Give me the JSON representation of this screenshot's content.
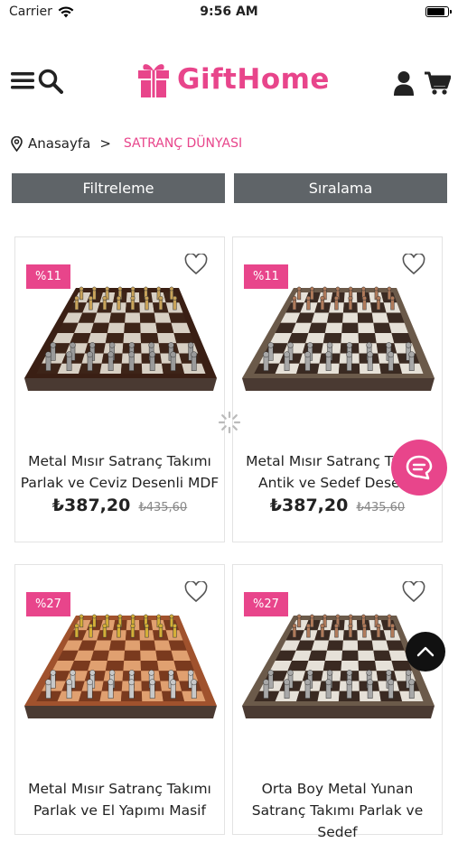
{
  "status_bar": {
    "carrier": "Carrier",
    "time": "9:56 AM",
    "battery_level": 0.9
  },
  "header": {
    "logo_text": "GiftHome",
    "brand_color": "#e8458b"
  },
  "breadcrumb": {
    "home": "Anasayfa",
    "separator": ">",
    "current": "SATRANÇ DÜNYASI"
  },
  "controls": {
    "filter_label": "Filtreleme",
    "sort_label": "Sıralama"
  },
  "products": [
    {
      "discount": "%11",
      "title": "Metal Mısır Satranç Takımı Parlak ve Ceviz Desenli MDF",
      "price": "₺387,20",
      "old_price": "₺435,60",
      "board": "walnut"
    },
    {
      "discount": "%11",
      "title": "Metal Mısır Satranç Takımı Antik ve Sedef Desenli",
      "price": "₺387,20",
      "old_price": "₺435,60",
      "board": "pearl"
    },
    {
      "discount": "%27",
      "title": "Metal Mısır Satranç Takımı Parlak ve El Yapımı Masif",
      "price": "",
      "old_price": "",
      "board": "wood"
    },
    {
      "discount": "%27",
      "title": "Orta Boy Metal Yunan Satranç Takımı Parlak ve Sedef",
      "price": "",
      "old_price": "",
      "board": "pearl"
    }
  ],
  "icons": [
    "menu-icon",
    "search-icon",
    "gift-icon",
    "user-icon",
    "cart-icon",
    "location-pin-icon",
    "heart-icon",
    "chat-icon",
    "arrow-up-icon",
    "loading-spinner-icon"
  ]
}
